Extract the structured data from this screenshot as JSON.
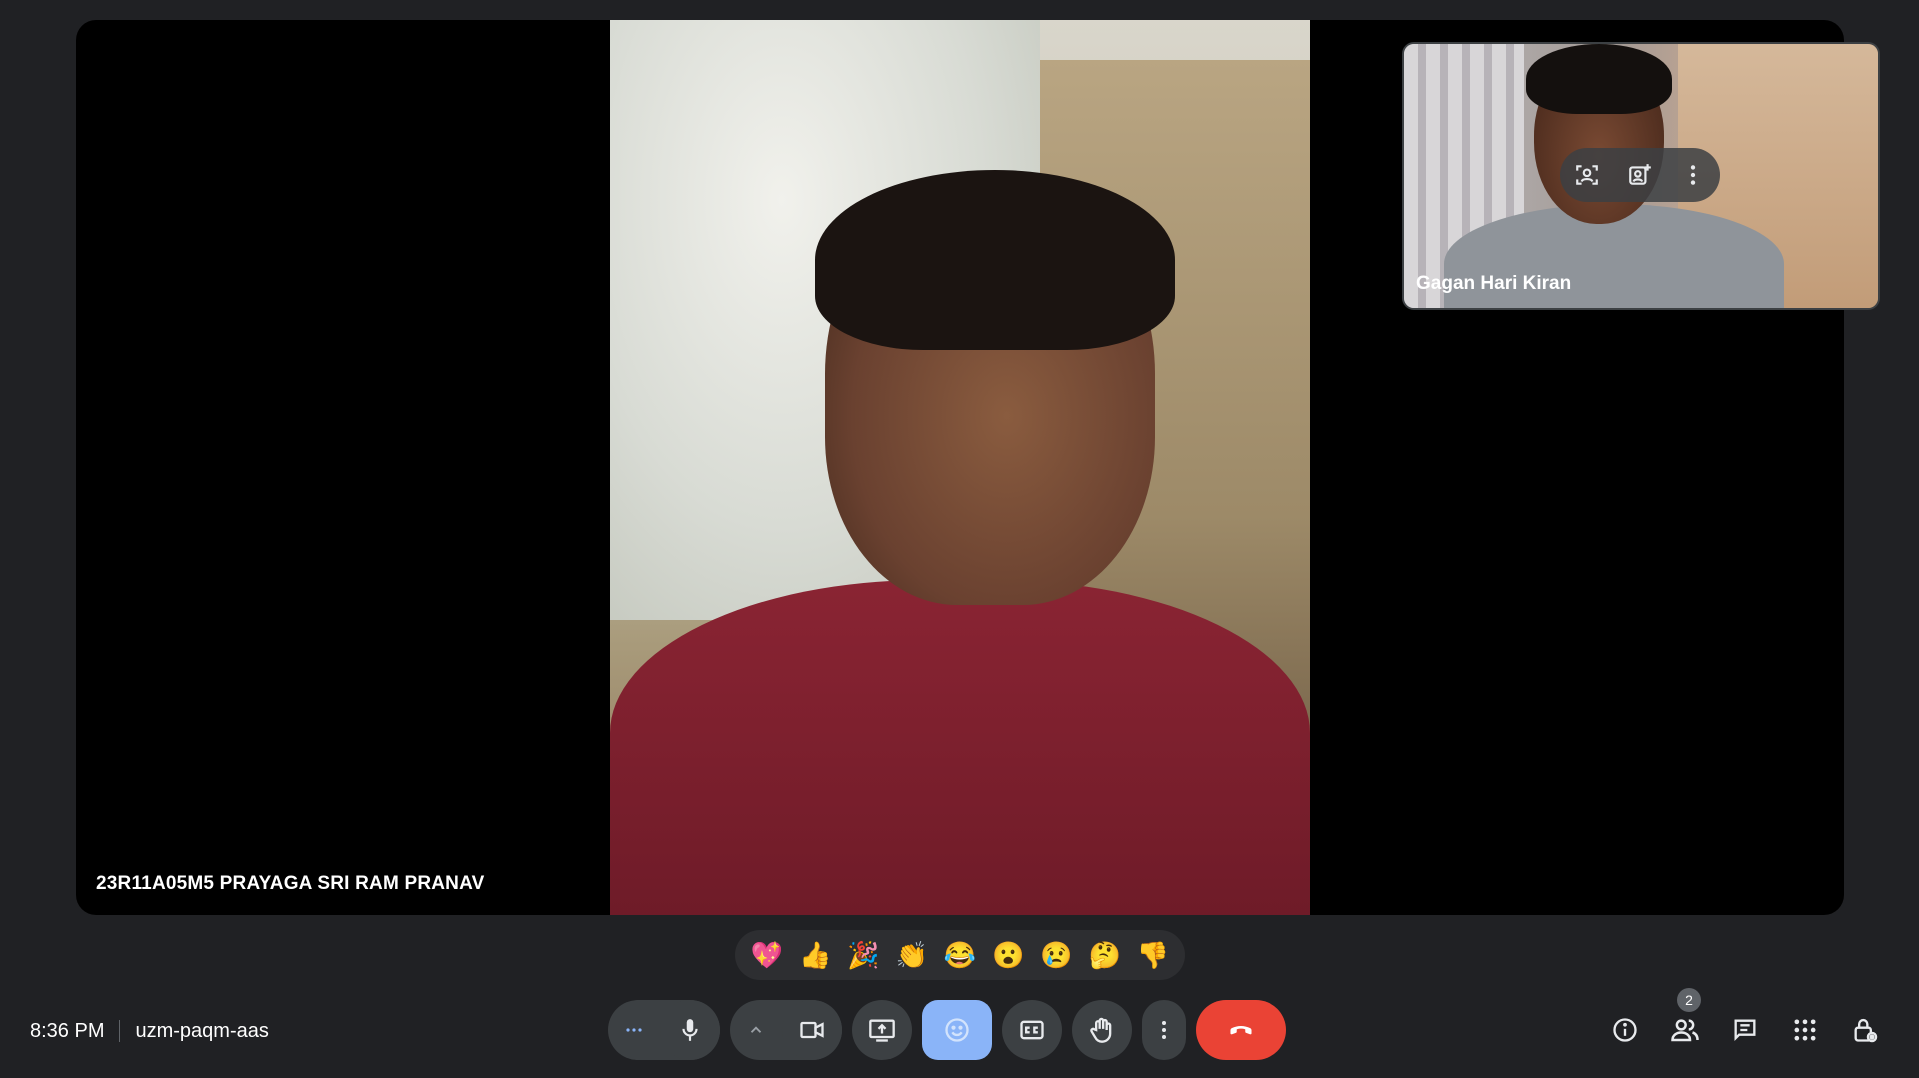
{
  "main_participant": {
    "name": "23R11A05M5 PRAYAGA SRI RAM PRANAV"
  },
  "pip_participant": {
    "name": "Gagan Hari Kiran"
  },
  "pip_controls": [
    "framing-icon",
    "add-background-icon",
    "more-options-icon"
  ],
  "reactions": [
    "💖",
    "👍",
    "🎉",
    "👏",
    "😂",
    "😮",
    "😢",
    "🤔",
    "👎"
  ],
  "meeting": {
    "time": "8:36 PM",
    "code": "uzm-paqm-aas"
  },
  "toolbar": {
    "buttons": [
      "more-audio-options-icon",
      "microphone-icon",
      "chevron-up-icon",
      "camera-icon",
      "present-screen-icon",
      "emoji-icon",
      "captions-icon",
      "raise-hand-icon",
      "more-options-icon",
      "end-call-icon"
    ]
  },
  "right_tools": {
    "participants_count": "2",
    "icons": [
      "info-icon",
      "people-icon",
      "chat-icon",
      "activities-icon",
      "host-controls-icon"
    ]
  },
  "colors": {
    "background": "#202124",
    "active": "#8ab4f8",
    "end_call": "#ea4335"
  }
}
